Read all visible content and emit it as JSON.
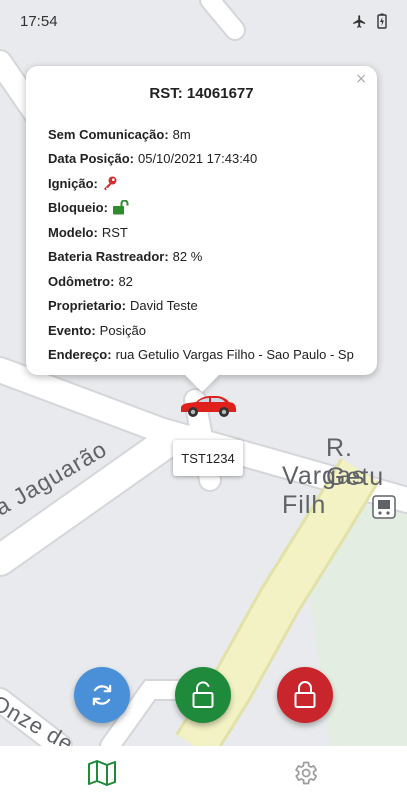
{
  "status_bar": {
    "time": "17:54",
    "icons": [
      "airplane-icon",
      "battery-charging-icon"
    ]
  },
  "map": {
    "street_labels": [
      "R. Getu",
      "Vargas Filh",
      "a Jaguarão",
      "Onze de"
    ],
    "colors": {
      "background": "#e8eaed",
      "road": "#ffffff",
      "highlight_road": "#f3f2c4",
      "park": "#e3ede1"
    }
  },
  "popup": {
    "close_glyph": "×",
    "title": "RST: 14061677",
    "rows": [
      {
        "label": "Sem Comunicação:",
        "value": "8m"
      },
      {
        "label": "Data Posição:",
        "value": "05/10/2021 17:43:40"
      },
      {
        "label": "Ignição:",
        "icon": "key-icon",
        "icon_color": "#d32f2f"
      },
      {
        "label": "Bloqueio:",
        "icon": "unlocked-padlock-icon",
        "icon_color": "#2e8b2e"
      },
      {
        "label": "Modelo:",
        "value": "RST"
      },
      {
        "label": "Bateria Rastreador:",
        "value": "82 %"
      },
      {
        "label": "Odômetro:",
        "value": "82"
      },
      {
        "label": "Proprietario:",
        "value": "David Teste"
      },
      {
        "label": "Evento:",
        "value": "Posição"
      },
      {
        "label": "Endereço:",
        "value": "rua Getulio Vargas Filho - Sao Paulo - Sp"
      }
    ]
  },
  "vehicle": {
    "plate": "TST1234",
    "icon": "car-icon",
    "color": "#e0201c"
  },
  "actions": [
    {
      "name": "refresh-button",
      "icon": "refresh-icon",
      "color": "#4a90d9"
    },
    {
      "name": "unlock-button",
      "icon": "unlocked-padlock-icon",
      "color": "#1f8a3b"
    },
    {
      "name": "lock-button",
      "icon": "locked-padlock-icon",
      "color": "#c9252c"
    }
  ],
  "bottom_nav": [
    {
      "name": "map-tab",
      "icon": "map-icon",
      "active": true,
      "color": "#1f8a3b"
    },
    {
      "name": "settings-tab",
      "icon": "gear-icon",
      "active": false,
      "color": "#9e9e9e"
    }
  ]
}
